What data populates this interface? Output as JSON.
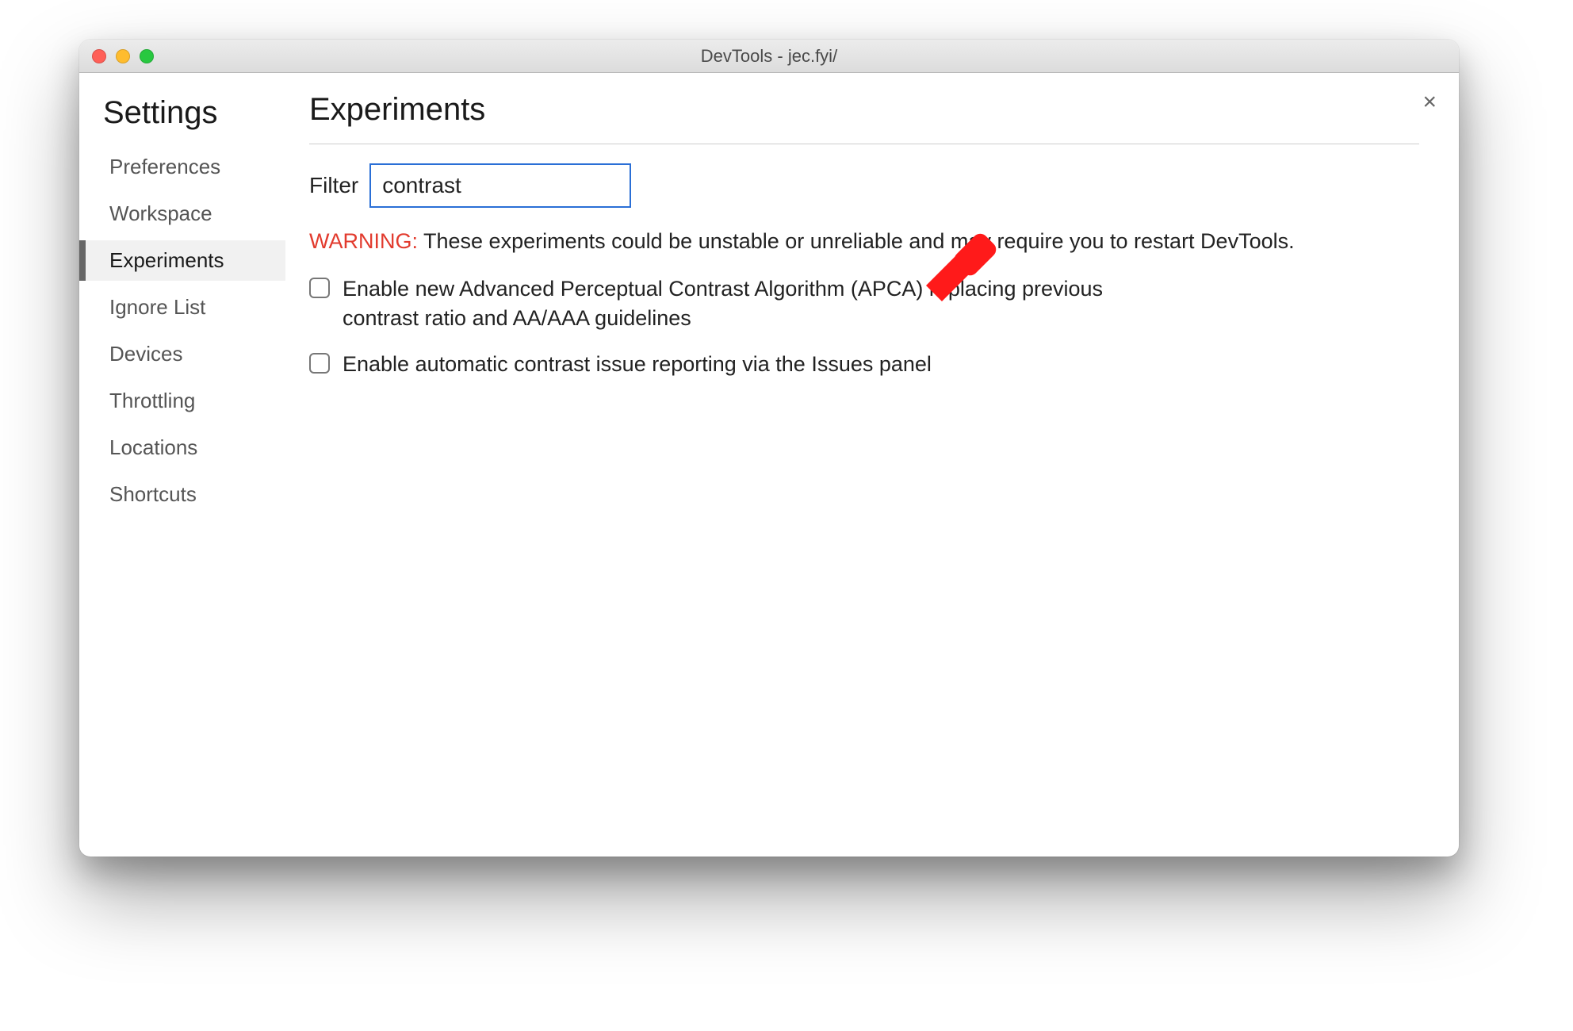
{
  "window": {
    "title": "DevTools - jec.fyi/"
  },
  "sidebar": {
    "heading": "Settings",
    "items": [
      {
        "label": "Preferences",
        "active": false
      },
      {
        "label": "Workspace",
        "active": false
      },
      {
        "label": "Experiments",
        "active": true
      },
      {
        "label": "Ignore List",
        "active": false
      },
      {
        "label": "Devices",
        "active": false
      },
      {
        "label": "Throttling",
        "active": false
      },
      {
        "label": "Locations",
        "active": false
      },
      {
        "label": "Shortcuts",
        "active": false
      }
    ]
  },
  "main": {
    "heading": "Experiments",
    "filter_label": "Filter",
    "filter_value": "contrast",
    "warning_tag": "WARNING:",
    "warning_text": "These experiments could be unstable or unreliable and may require you to restart DevTools.",
    "experiments": [
      {
        "checked": false,
        "label": "Enable new Advanced Perceptual Contrast Algorithm (APCA) replacing previous contrast ratio and AA/AAA guidelines"
      },
      {
        "checked": false,
        "label": "Enable automatic contrast issue reporting via the Issues panel"
      }
    ]
  },
  "close_label": "×"
}
